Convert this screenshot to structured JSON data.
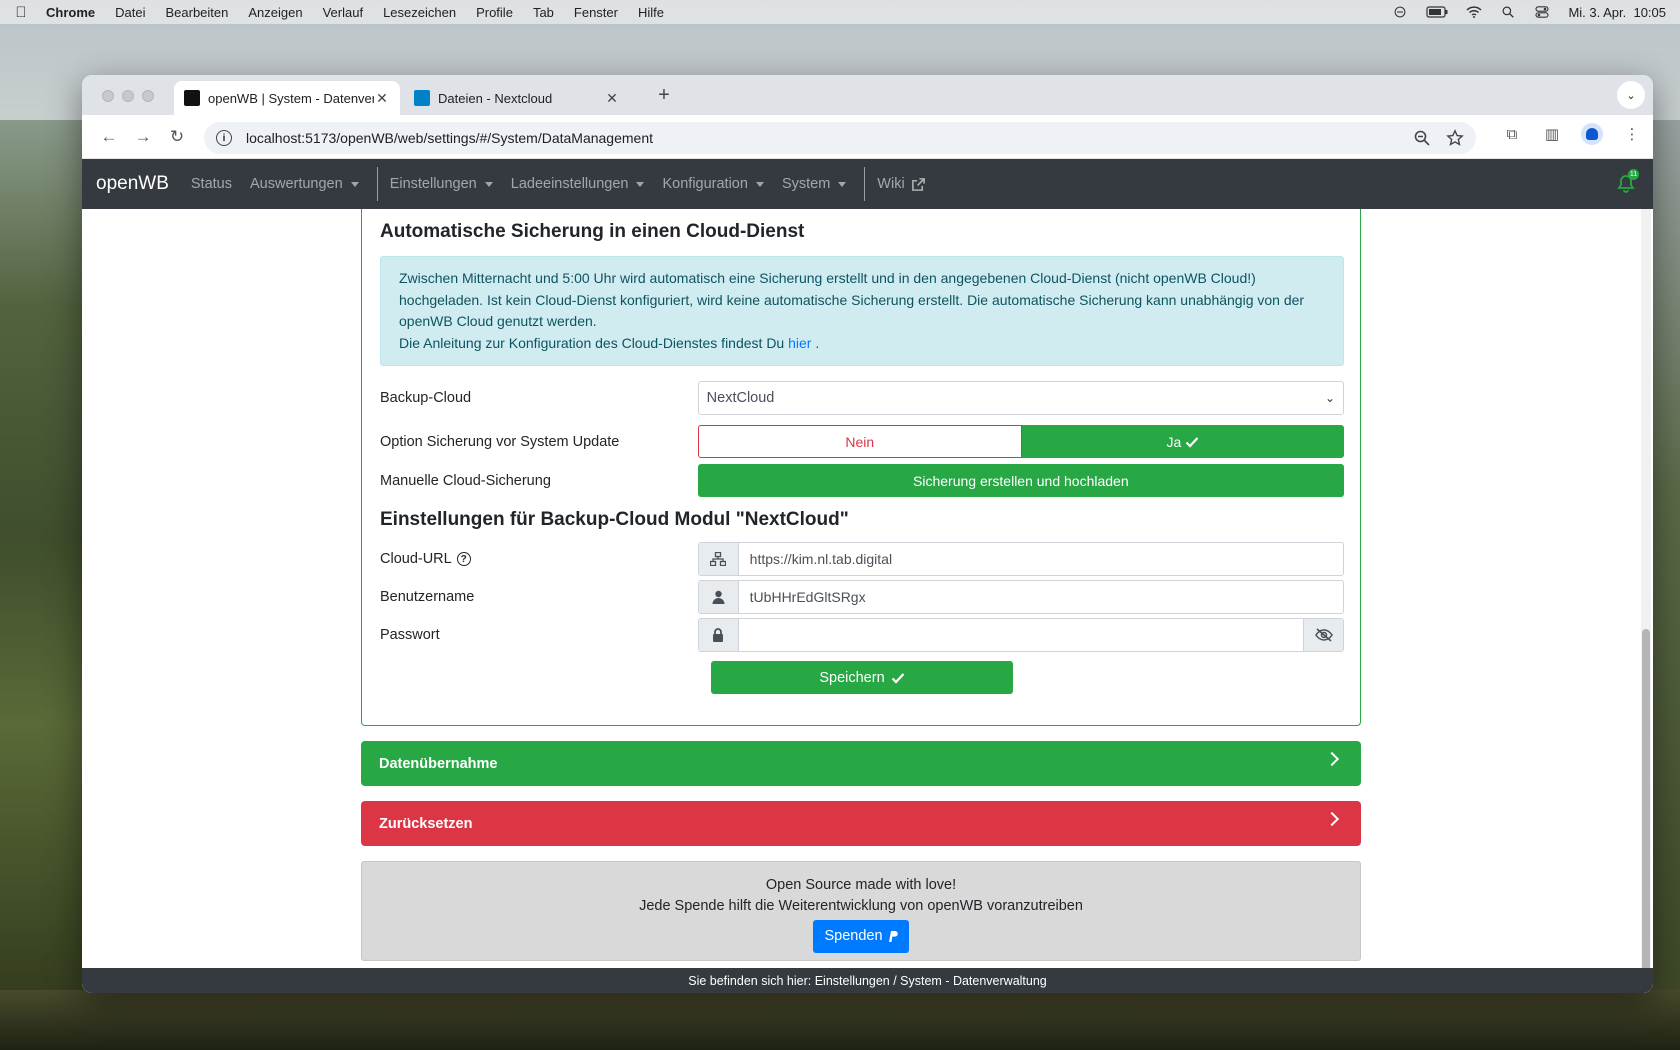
{
  "menubar": {
    "app_name": "Chrome",
    "items": [
      "Datei",
      "Bearbeiten",
      "Anzeigen",
      "Verlauf",
      "Lesezeichen",
      "Profile",
      "Tab",
      "Fenster",
      "Hilfe"
    ],
    "clock": "Mi. 3. Apr.  10:05"
  },
  "browser": {
    "tabs": [
      {
        "title": "openWB | System - Datenverwaltung",
        "active": true
      },
      {
        "title": "Dateien - Nextcloud",
        "active": false
      }
    ],
    "url": "localhost:5173/openWB/web/settings/#/System/DataManagement"
  },
  "navbar": {
    "brand": "openWB",
    "links": {
      "status": "Status",
      "auswertungen": "Auswertungen",
      "einstellungen": "Einstellungen",
      "ladeeinstellungen": "Ladeeinstellungen",
      "konfiguration": "Konfiguration",
      "system": "System",
      "wiki": "Wiki"
    },
    "notification_count": "11"
  },
  "backup_card": {
    "title": "Automatische Sicherung in einen Cloud-Dienst",
    "info_text": "Zwischen Mitternacht und 5:00 Uhr wird automatisch eine Sicherung erstellt und in den angegebenen Cloud-Dienst (nicht openWB Cloud!) hochgeladen. Ist kein Cloud-Dienst konfiguriert, wird keine automatische Sicherung erstellt. Die automatische Sicherung kann unabhängig von der openWB Cloud genutzt werden.",
    "info_link_prefix": "Die Anleitung zur Konfiguration des Cloud-Dienstes findest Du",
    "info_link_text": "hier",
    "info_link_suffix": ".",
    "backup_cloud_label": "Backup-Cloud",
    "backup_cloud_value": "NextCloud",
    "update_option_label": "Option Sicherung vor System Update",
    "option_no": "Nein",
    "option_yes": "Ja",
    "manual_label": "Manuelle Cloud-Sicherung",
    "manual_button": "Sicherung erstellen und hochladen",
    "module_title": "Einstellungen für Backup-Cloud Modul \"NextCloud\"",
    "url_label": "Cloud-URL",
    "url_value": "https://kim.nl.tab.digital",
    "user_label": "Benutzername",
    "user_value": "tUbHHrEdGltSRgx",
    "password_label": "Passwort",
    "password_value": "",
    "save_button": "Speichern"
  },
  "sections": {
    "datenuebernahme": "Datenübernahme",
    "zuruecksetzen": "Zurücksetzen"
  },
  "donate": {
    "line1": "Open Source made with love!",
    "line2": "Jede Spende hilft die Weiterentwicklung von openWB voranzutreiben",
    "button": "Spenden"
  },
  "footer": {
    "breadcrumb": "Sie befinden sich hier: Einstellungen / System - Datenverwaltung"
  }
}
